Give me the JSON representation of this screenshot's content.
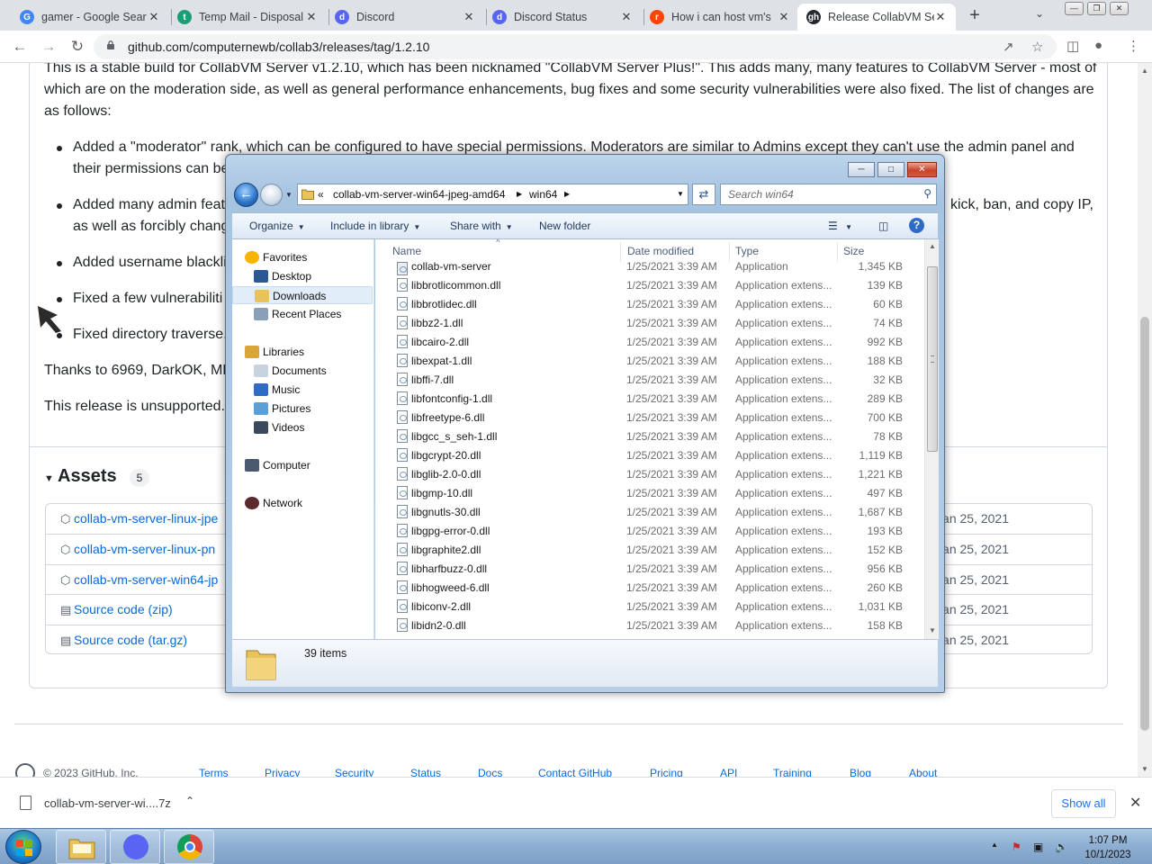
{
  "browser": {
    "tabs": [
      {
        "title": "gamer - Google Sear",
        "favicon": "G",
        "favicon_color": "#4285f4",
        "active": false
      },
      {
        "title": "Temp Mail - Disposal",
        "favicon": "t",
        "favicon_color": "#1a9e76",
        "active": false
      },
      {
        "title": "Discord",
        "favicon": "d",
        "favicon_color": "#5865f2",
        "active": false
      },
      {
        "title": "Discord Status",
        "favicon": "d",
        "favicon_color": "#5865f2",
        "active": false
      },
      {
        "title": "How i can host vm's",
        "favicon": "r",
        "favicon_color": "#ff4500",
        "active": false
      },
      {
        "title": "Release CollabVM Se",
        "favicon": "gh",
        "favicon_color": "#24292f",
        "active": true
      }
    ],
    "url": "github.com/computernewb/collab3/releases/tag/1.2.10"
  },
  "github": {
    "intro": [
      "This is a stable build for CollabVM Server v1.2.10, which has been nicknamed \"CollabVM Server Plus!\". This adds many, many features to CollabVM Server - most of",
      "which are on the moderation side, as well as general performance enhancements, bug fixes and some security vulnerabilities were also fixed. The list of changes are",
      "as follows:"
    ],
    "bullets": [
      {
        "l1": "Added a \"moderator\" rank, which can be configured to have special permissions. Moderators are similar to Admins except they can't use the admin panel and",
        "l2": "their permissions can be"
      },
      {
        "l1": "Added many admin feat",
        "l1r": "kick, ban, and copy IP,",
        "l2": "as well as forcibly chang"
      },
      {
        "l1": "Added username blackli"
      },
      {
        "l1": "Fixed a few vulnerabiliti"
      },
      {
        "l1": "Fixed directory traverse."
      }
    ],
    "thanks": "Thanks to 6969, DarkOK, MD",
    "unsupported": "This release is unsupported.",
    "assets_title": "Assets",
    "assets_count": "5",
    "assets": [
      {
        "name": "collab-vm-server-linux-jpe",
        "date": "Jan 25, 2021",
        "icon": "package-icon"
      },
      {
        "name": "collab-vm-server-linux-pn",
        "date": "Jan 25, 2021",
        "icon": "package-icon"
      },
      {
        "name": "collab-vm-server-win64-jp",
        "date": "Jan 25, 2021",
        "icon": "package-icon"
      },
      {
        "name": "Source code (zip)",
        "date": "Jan 25, 2021",
        "icon": "file-zip-icon"
      },
      {
        "name": "Source code (tar.gz)",
        "date": "Jan 25, 2021",
        "icon": "file-zip-icon"
      }
    ],
    "footer": {
      "copyright": "© 2023 GitHub, Inc.",
      "links": [
        "Terms",
        "Privacy",
        "Security",
        "Status",
        "Docs",
        "Contact GitHub",
        "Pricing",
        "API",
        "Training",
        "Blog",
        "About"
      ]
    }
  },
  "download_bar": {
    "file_name": "collab-vm-server-wi....7z",
    "show_all": "Show all"
  },
  "explorer": {
    "breadcrumb": [
      "«",
      "collab-vm-server-win64-jpeg-amd64",
      "win64"
    ],
    "search_placeholder": "Search win64",
    "commands": [
      "Organize",
      "Include in library",
      "Share with",
      "New folder"
    ],
    "nav": [
      {
        "label": "Favorites",
        "group": true,
        "icon": "star-icon"
      },
      {
        "label": "Desktop",
        "group": false,
        "icon": "desktop-icon"
      },
      {
        "label": "Downloads",
        "group": false,
        "icon": "downloads-folder-icon",
        "selected": true
      },
      {
        "label": "Recent Places",
        "group": false,
        "icon": "recent-places-icon"
      },
      {
        "label": "Libraries",
        "group": true,
        "icon": "libraries-icon"
      },
      {
        "label": "Documents",
        "group": false,
        "icon": "documents-icon"
      },
      {
        "label": "Music",
        "group": false,
        "icon": "music-icon"
      },
      {
        "label": "Pictures",
        "group": false,
        "icon": "pictures-icon"
      },
      {
        "label": "Videos",
        "group": false,
        "icon": "videos-icon"
      },
      {
        "label": "Computer",
        "group": true,
        "icon": "computer-icon"
      },
      {
        "label": "Network",
        "group": true,
        "icon": "network-icon"
      }
    ],
    "columns": [
      "Name",
      "Date modified",
      "Type",
      "Size"
    ],
    "files": [
      {
        "name": "collab-vm-server",
        "date": "1/25/2021 3:39 AM",
        "type": "Application",
        "size": "1,345 KB"
      },
      {
        "name": "libbrotlicommon.dll",
        "date": "1/25/2021 3:39 AM",
        "type": "Application extens...",
        "size": "139 KB"
      },
      {
        "name": "libbrotlidec.dll",
        "date": "1/25/2021 3:39 AM",
        "type": "Application extens...",
        "size": "60 KB"
      },
      {
        "name": "libbz2-1.dll",
        "date": "1/25/2021 3:39 AM",
        "type": "Application extens...",
        "size": "74 KB"
      },
      {
        "name": "libcairo-2.dll",
        "date": "1/25/2021 3:39 AM",
        "type": "Application extens...",
        "size": "992 KB"
      },
      {
        "name": "libexpat-1.dll",
        "date": "1/25/2021 3:39 AM",
        "type": "Application extens...",
        "size": "188 KB"
      },
      {
        "name": "libffi-7.dll",
        "date": "1/25/2021 3:39 AM",
        "type": "Application extens...",
        "size": "32 KB"
      },
      {
        "name": "libfontconfig-1.dll",
        "date": "1/25/2021 3:39 AM",
        "type": "Application extens...",
        "size": "289 KB"
      },
      {
        "name": "libfreetype-6.dll",
        "date": "1/25/2021 3:39 AM",
        "type": "Application extens...",
        "size": "700 KB"
      },
      {
        "name": "libgcc_s_seh-1.dll",
        "date": "1/25/2021 3:39 AM",
        "type": "Application extens...",
        "size": "78 KB"
      },
      {
        "name": "libgcrypt-20.dll",
        "date": "1/25/2021 3:39 AM",
        "type": "Application extens...",
        "size": "1,119 KB"
      },
      {
        "name": "libglib-2.0-0.dll",
        "date": "1/25/2021 3:39 AM",
        "type": "Application extens...",
        "size": "1,221 KB"
      },
      {
        "name": "libgmp-10.dll",
        "date": "1/25/2021 3:39 AM",
        "type": "Application extens...",
        "size": "497 KB"
      },
      {
        "name": "libgnutls-30.dll",
        "date": "1/25/2021 3:39 AM",
        "type": "Application extens...",
        "size": "1,687 KB"
      },
      {
        "name": "libgpg-error-0.dll",
        "date": "1/25/2021 3:39 AM",
        "type": "Application extens...",
        "size": "193 KB"
      },
      {
        "name": "libgraphite2.dll",
        "date": "1/25/2021 3:39 AM",
        "type": "Application extens...",
        "size": "152 KB"
      },
      {
        "name": "libharfbuzz-0.dll",
        "date": "1/25/2021 3:39 AM",
        "type": "Application extens...",
        "size": "956 KB"
      },
      {
        "name": "libhogweed-6.dll",
        "date": "1/25/2021 3:39 AM",
        "type": "Application extens...",
        "size": "260 KB"
      },
      {
        "name": "libiconv-2.dll",
        "date": "1/25/2021 3:39 AM",
        "type": "Application extens...",
        "size": "1,031 KB"
      },
      {
        "name": "libidn2-0.dll",
        "date": "1/25/2021 3:39 AM",
        "type": "Application extens...",
        "size": "158 KB"
      }
    ],
    "item_count": "39 items"
  },
  "taskbar": {
    "time": "1:07 PM",
    "date": "10/1/2023"
  }
}
